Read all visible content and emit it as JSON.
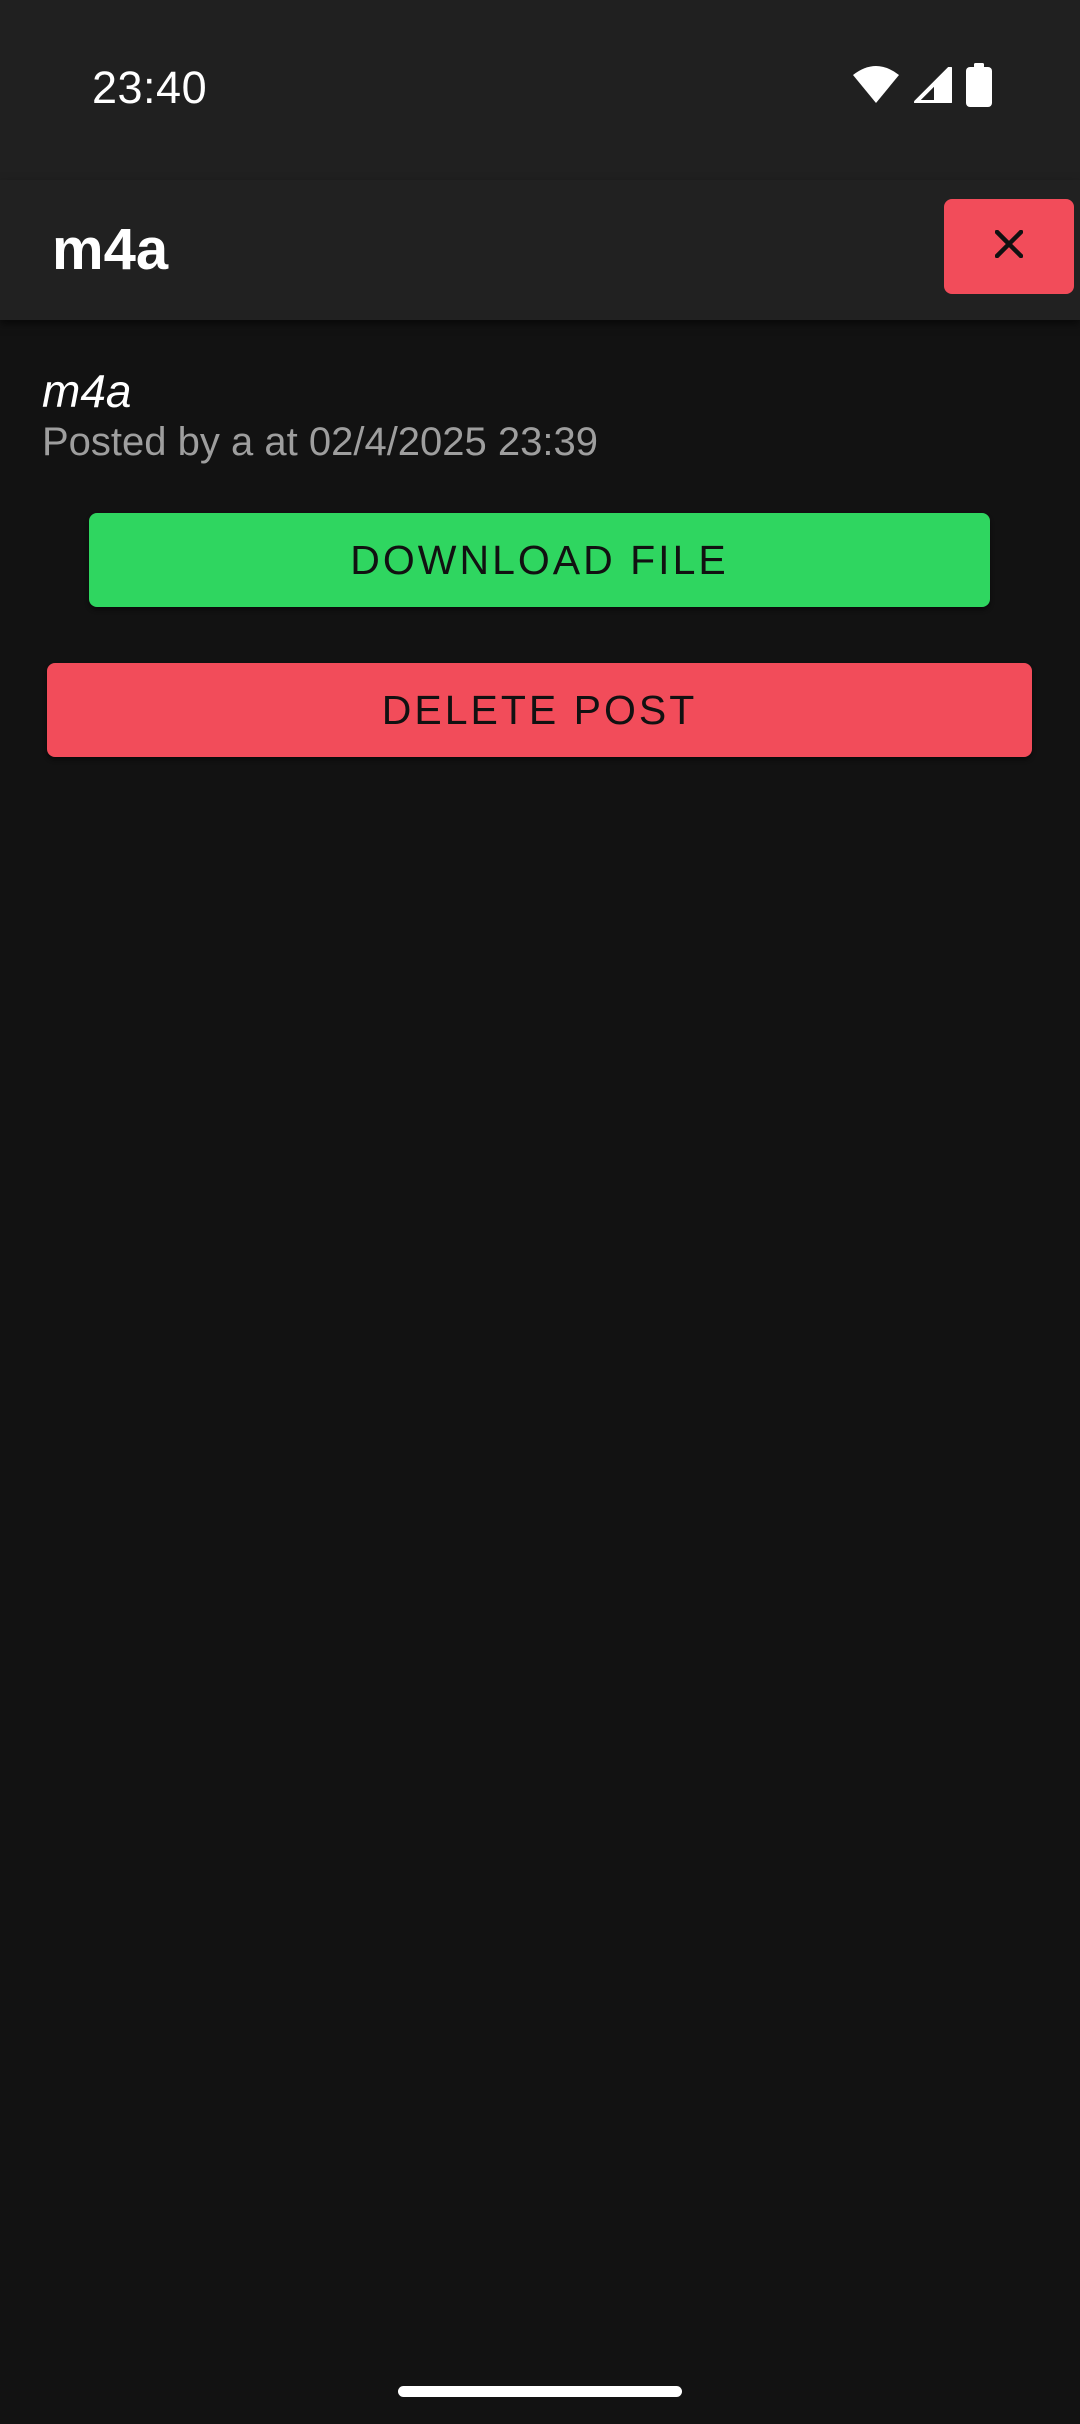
{
  "status_bar": {
    "time": "23:40",
    "icons": [
      "wifi-icon",
      "cellular-signal-icon",
      "battery-icon"
    ]
  },
  "app_bar": {
    "title": "m4a",
    "close_icon": "close-icon"
  },
  "post": {
    "title": "m4a",
    "meta": "Posted by a at 02/4/2025 23:39"
  },
  "actions": {
    "download_label": "DOWNLOAD FILE",
    "delete_label": "DELETE POST"
  },
  "colors": {
    "background": "#121212",
    "app_bar": "#212121",
    "download": "#2fd660",
    "delete": "#f24c5a",
    "meta_text": "#9e9e9e"
  }
}
